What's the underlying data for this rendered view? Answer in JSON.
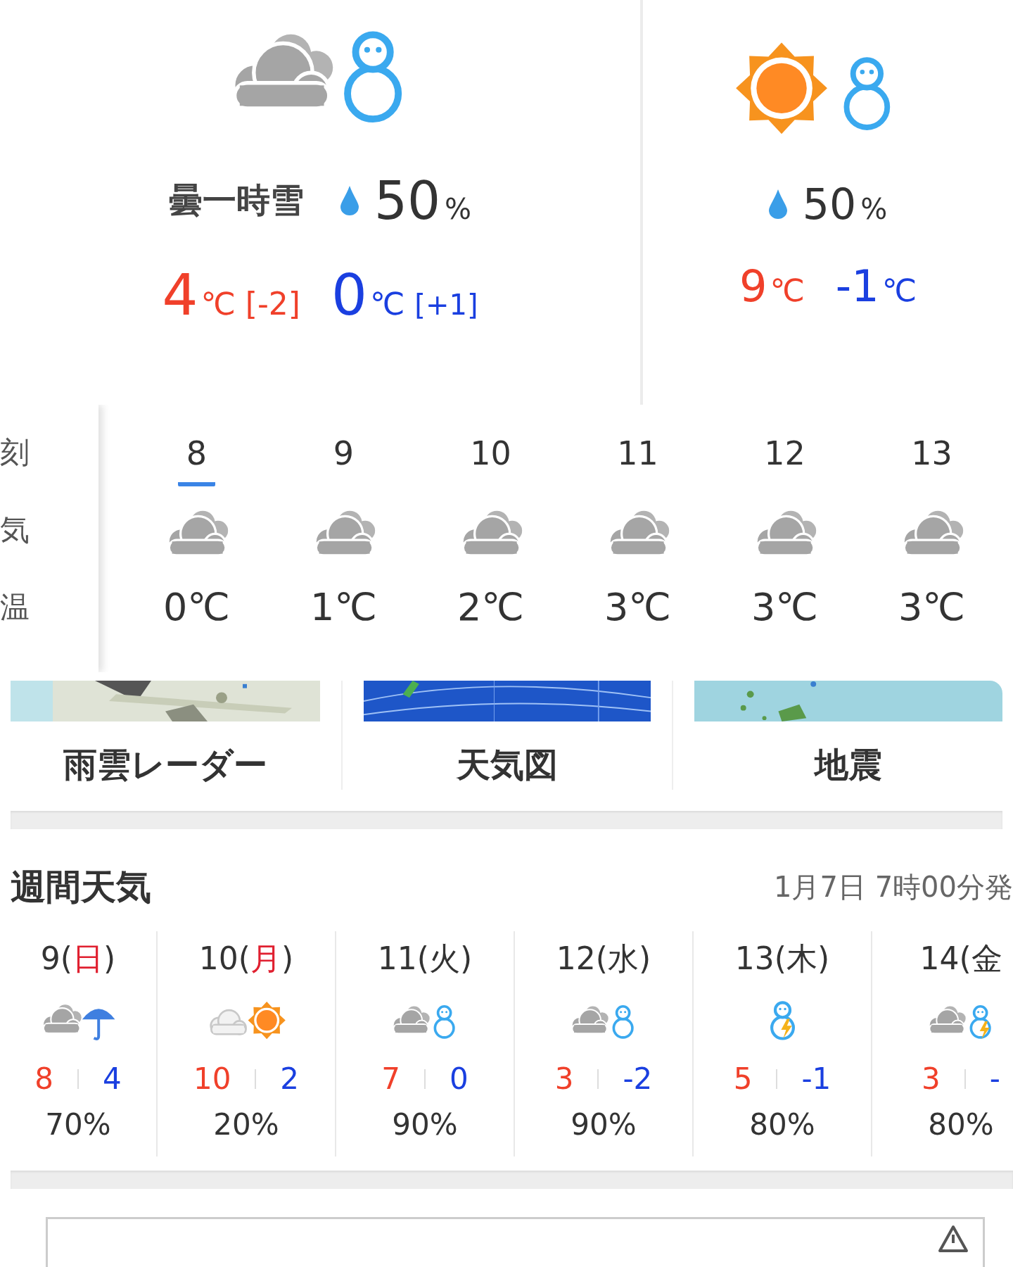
{
  "current": [
    {
      "kind": "cloud_snow",
      "condition": "曇一時雪",
      "pop": "50",
      "pop_unit": "%",
      "high": {
        "value": "4",
        "unit": "℃",
        "diff": "[-2]"
      },
      "low": {
        "value": "0",
        "unit": "℃",
        "diff": "[+1]"
      }
    },
    {
      "kind": "sun_snow",
      "pop": "50",
      "pop_unit": "%",
      "high": {
        "value": "9",
        "unit": "℃"
      },
      "low": {
        "value": "-1",
        "unit": "℃"
      }
    }
  ],
  "hourly": {
    "row_labels": [
      "刻",
      "気",
      "温"
    ],
    "hours": [
      {
        "hour": "8",
        "kind": "cloud",
        "temp": "0℃",
        "selected": true
      },
      {
        "hour": "9",
        "kind": "cloud",
        "temp": "1℃",
        "selected": false
      },
      {
        "hour": "10",
        "kind": "cloud",
        "temp": "2℃",
        "selected": false
      },
      {
        "hour": "11",
        "kind": "cloud",
        "temp": "3℃",
        "selected": false
      },
      {
        "hour": "12",
        "kind": "cloud",
        "temp": "3℃",
        "selected": false
      },
      {
        "hour": "13",
        "kind": "cloud",
        "temp": "3℃",
        "selected": false
      }
    ]
  },
  "links": [
    {
      "kind": "radar",
      "label": "雨雲レーダー"
    },
    {
      "kind": "chart",
      "label": "天気図"
    },
    {
      "kind": "quake",
      "label": "地震"
    }
  ],
  "weekly": {
    "title": "週間天気",
    "issued": "1月7日 7時00分発",
    "days": [
      {
        "day": "9(",
        "weekday": "日",
        "end": ")",
        "holiday": true,
        "kind": "cloud_rain",
        "high": "8",
        "low": "4",
        "pop": "70%"
      },
      {
        "day": "10(",
        "weekday": "月",
        "end": ")",
        "holiday": true,
        "kind": "cloud_sun",
        "high": "10",
        "low": "2",
        "pop": "20%"
      },
      {
        "day": "11(",
        "weekday": "火",
        "end": ")",
        "holiday": false,
        "kind": "cloud_snow",
        "high": "7",
        "low": "0",
        "pop": "90%"
      },
      {
        "day": "12(",
        "weekday": "水",
        "end": ")",
        "holiday": false,
        "kind": "cloud_snow",
        "high": "3",
        "low": "-2",
        "pop": "90%"
      },
      {
        "day": "13(",
        "weekday": "木",
        "end": ")",
        "holiday": false,
        "kind": "snow_thunder",
        "high": "5",
        "low": "-1",
        "pop": "80%"
      },
      {
        "day": "14(",
        "weekday": "金",
        "holiday": false,
        "kind": "cloud_snow_thunder",
        "high": "3",
        "low": "-",
        "pop": "80%"
      }
    ]
  }
}
